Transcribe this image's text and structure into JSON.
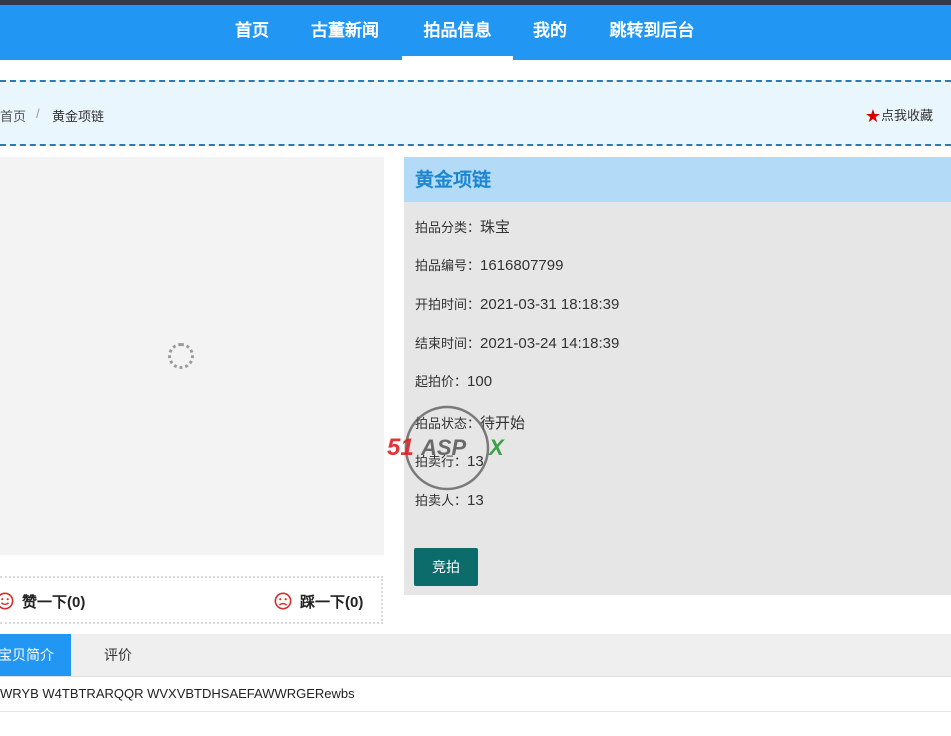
{
  "nav": {
    "items": [
      {
        "label": "首页"
      },
      {
        "label": "古董新闻"
      },
      {
        "label": "拍品信息"
      },
      {
        "label": "我的"
      },
      {
        "label": "跳转到后台"
      }
    ],
    "active": "拍品信息"
  },
  "breadcrumb": {
    "home": "首页",
    "separator": "/",
    "current": "黄金项链"
  },
  "favorite": {
    "icon": "star-icon",
    "label": "点我收藏"
  },
  "vote": {
    "like_label": "赞一下(0)",
    "dislike_label": "踩一下(0)"
  },
  "item": {
    "title": "黄金项链",
    "fields": [
      {
        "label": "拍品分类：",
        "value": "珠宝"
      },
      {
        "label": "拍品编号：",
        "value": "1616807799"
      },
      {
        "label": "开拍时间：",
        "value": "2021-03-31 18:18:39"
      },
      {
        "label": "结束时间：",
        "value": "2021-03-24 14:18:39"
      },
      {
        "label": "起拍价：",
        "value": "100"
      },
      {
        "label": "拍品状态：",
        "value": "待开始"
      },
      {
        "label": "拍卖行：",
        "value": "13"
      },
      {
        "label": "拍卖人：",
        "value": "13"
      }
    ],
    "bid_button": "竞拍"
  },
  "tabs": [
    {
      "label": "宝贝简介"
    },
    {
      "label": "评价"
    }
  ],
  "description": "WRYB W4TBTRARQQR WVXVBTDHSAEFAWWRGERewbs",
  "watermark": {
    "brand": "51ASPX"
  },
  "colors": {
    "nav_bg": "#2196f3",
    "title_bg": "#b3dbf8",
    "title_text": "#1c86d1",
    "bid_button_bg": "#0c6b6b",
    "star": "#d40000"
  }
}
